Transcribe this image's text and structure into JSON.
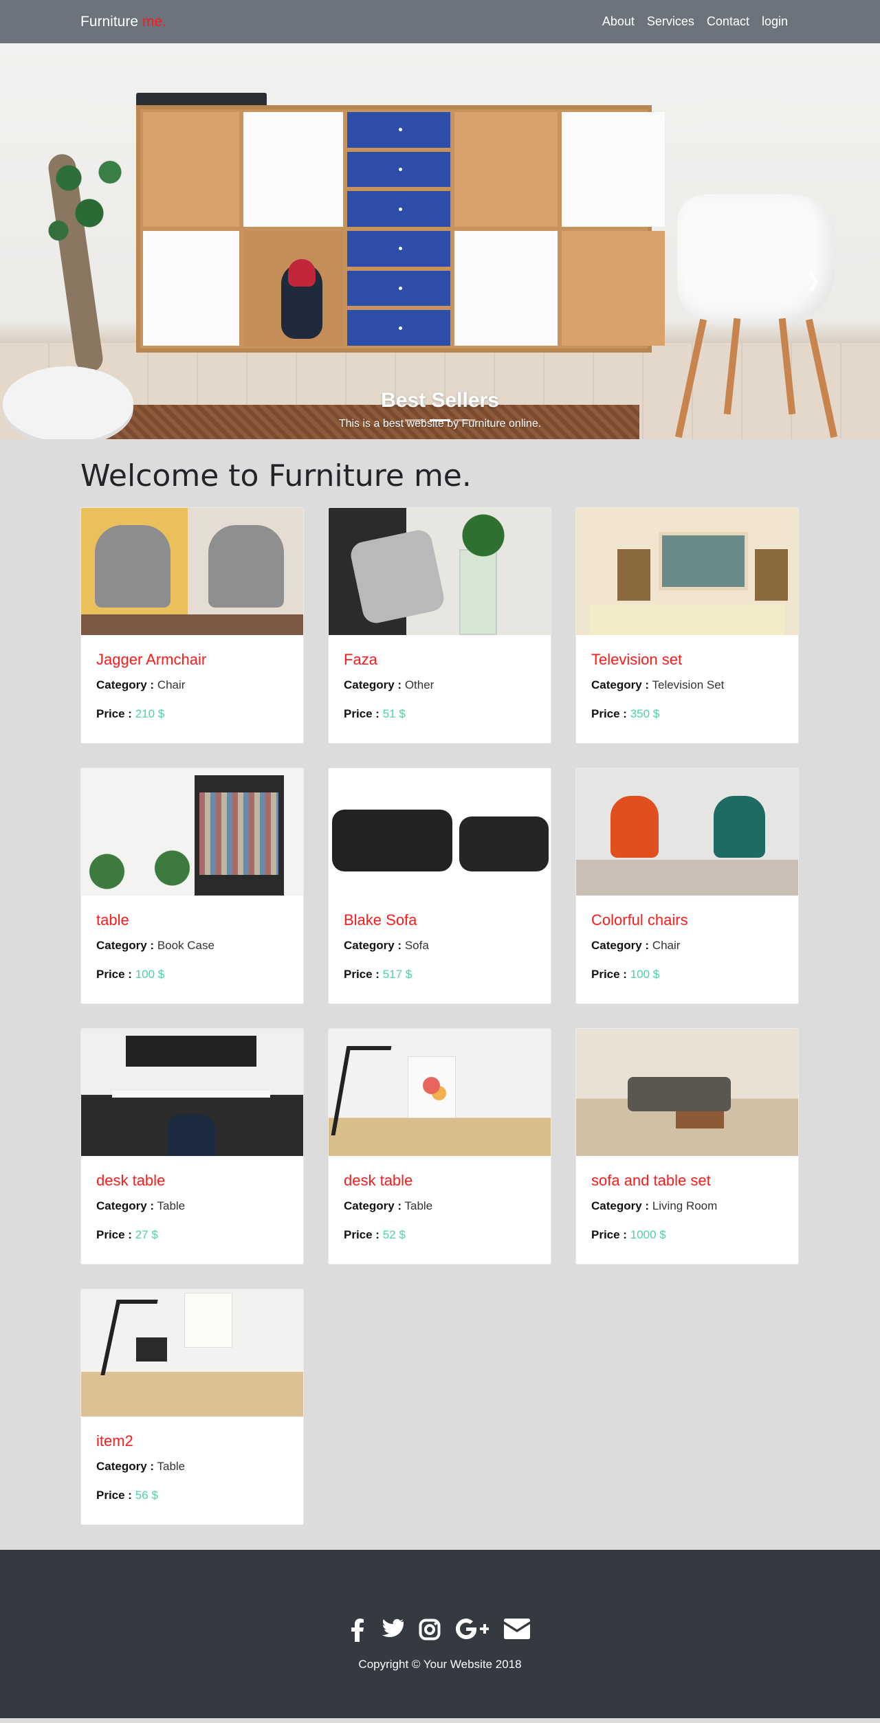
{
  "nav": {
    "brand_main": "Furniture",
    "brand_accent": "me.",
    "links": [
      "About",
      "Services",
      "Contact",
      "login"
    ]
  },
  "hero": {
    "title": "Best Sellers",
    "subtitle": "This is a best website by Furniture online.",
    "indicator_count": 3,
    "active_indicator": 1,
    "next_icon": "chevron-right-icon"
  },
  "main": {
    "title": "Welcome to Furniture me.",
    "category_label": "Category :",
    "price_label": "Price :",
    "products": [
      {
        "name": "Jagger Armchair",
        "category": "Chair",
        "price": "210 $"
      },
      {
        "name": "Faza",
        "category": "Other",
        "price": "51 $"
      },
      {
        "name": "Television set",
        "category": "Television Set",
        "price": "350 $"
      },
      {
        "name": "table",
        "category": "Book Case",
        "price": "100 $"
      },
      {
        "name": "Blake Sofa",
        "category": "Sofa",
        "price": "517 $"
      },
      {
        "name": "Colorful chairs",
        "category": "Chair",
        "price": "100 $"
      },
      {
        "name": "desk table",
        "category": "Table",
        "price": "27 $"
      },
      {
        "name": "desk table",
        "category": "Table",
        "price": "52 $"
      },
      {
        "name": "sofa and table set",
        "category": "Living Room",
        "price": "1000 $"
      },
      {
        "name": "item2",
        "category": "Table",
        "price": "56 $"
      }
    ]
  },
  "footer": {
    "social_icons": [
      "facebook-icon",
      "twitter-icon",
      "instagram-icon",
      "google-plus-icon",
      "envelope-icon"
    ],
    "copyright": "Copyright © Your Website 2018"
  },
  "colors": {
    "navbar": "#6c737c",
    "accent_red": "#ff1a1a",
    "price_green": "#4cd4a0",
    "page_bg": "#dcdcdc",
    "footer_bg": "#343a40"
  }
}
